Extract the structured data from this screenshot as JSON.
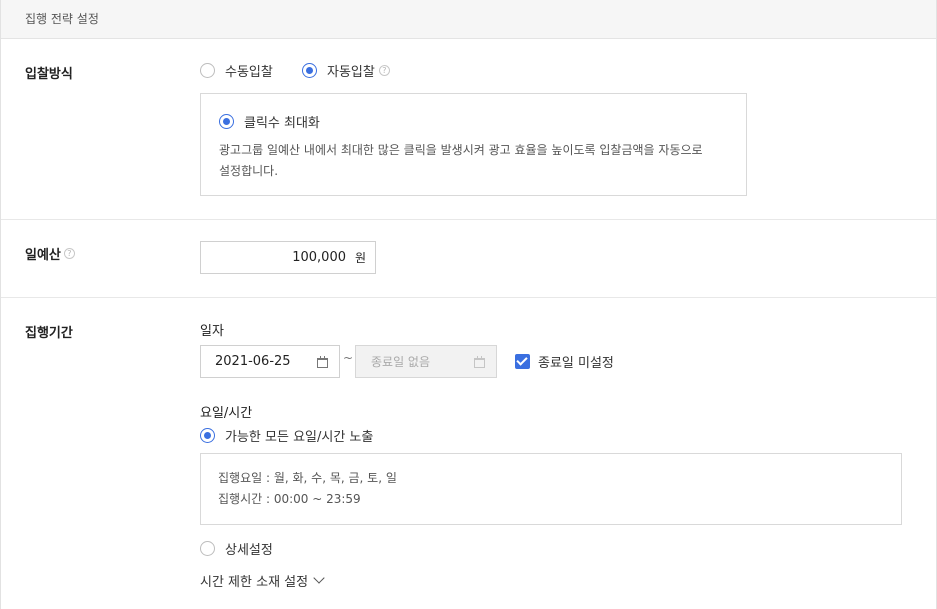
{
  "header": {
    "title": "집행 전략 설정"
  },
  "bid": {
    "label": "입찰방식",
    "options": [
      {
        "label": "수동입찰",
        "selected": false
      },
      {
        "label": "자동입찰",
        "selected": true
      }
    ],
    "strategy": {
      "label": "클릭수 최대화",
      "selected": true,
      "description_line1": "광고그룹 일예산 내에서 최대한 많은 클릭을 발생시켜 광고 효율을 높이도록 입찰금액을 자동으로",
      "description_line2": "설정합니다."
    }
  },
  "budget": {
    "label": "일예산",
    "value": "100,000",
    "unit": "원"
  },
  "period": {
    "label": "집행기간",
    "date_label": "일자",
    "start_date": "2021-06-25",
    "separator": "~",
    "end_placeholder": "종료일 없음",
    "no_end_label": "종료일 미설정",
    "no_end_checked": true,
    "dayparting_label": "요일/시간",
    "all_times_label": "가능한 모든 요일/시간 노출",
    "summary_days": "집행요일 : 월, 화, 수, 목, 금, 토, 일",
    "summary_time": "집행시간 : 00:00 ~ 23:59",
    "detail_label": "상세설정",
    "time_limit_label": "시간 제한 소재 설정"
  },
  "colors": {
    "accent": "#3a6fe0",
    "header_bg": "#f6f6f6",
    "border": "#d9d9d9"
  }
}
